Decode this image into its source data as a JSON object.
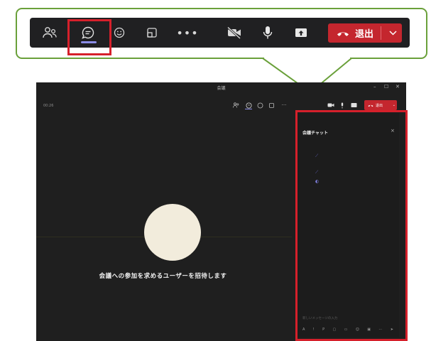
{
  "zoomed_toolbar": {
    "leave_label": "退出",
    "icons": {
      "people": "people-icon",
      "chat": "chat-icon",
      "react": "reaction-icon",
      "share_tray": "share-tray-icon",
      "more": "more-icon",
      "more_glyph": "•••",
      "camera": "camera-off-icon",
      "mic": "microphone-icon",
      "share": "share-screen-icon",
      "phone": "hang-up-icon",
      "caret": "chevron-down-icon"
    }
  },
  "window": {
    "title": "会議",
    "elapsed": "00:26",
    "min": "–",
    "max": "☐",
    "close": "✕",
    "leave_label": "退出",
    "caret": "⌄",
    "more_glyph": "···"
  },
  "stage": {
    "invite_text": "会議への参加を求めるユーザーを招待します"
  },
  "chat": {
    "title": "会議チャット",
    "close": "×",
    "compose_placeholder": "新しいメッセージの入力",
    "compose_icons": [
      "A",
      "!",
      "P",
      "▢",
      "▭",
      "☺",
      "▣",
      "⋯",
      "➤"
    ]
  },
  "colors": {
    "callout_border": "#6aa03a",
    "highlight": "#d6202b",
    "leave": "#c4262e",
    "accent": "#8b8de6",
    "window_bg": "#1f1f1f"
  }
}
